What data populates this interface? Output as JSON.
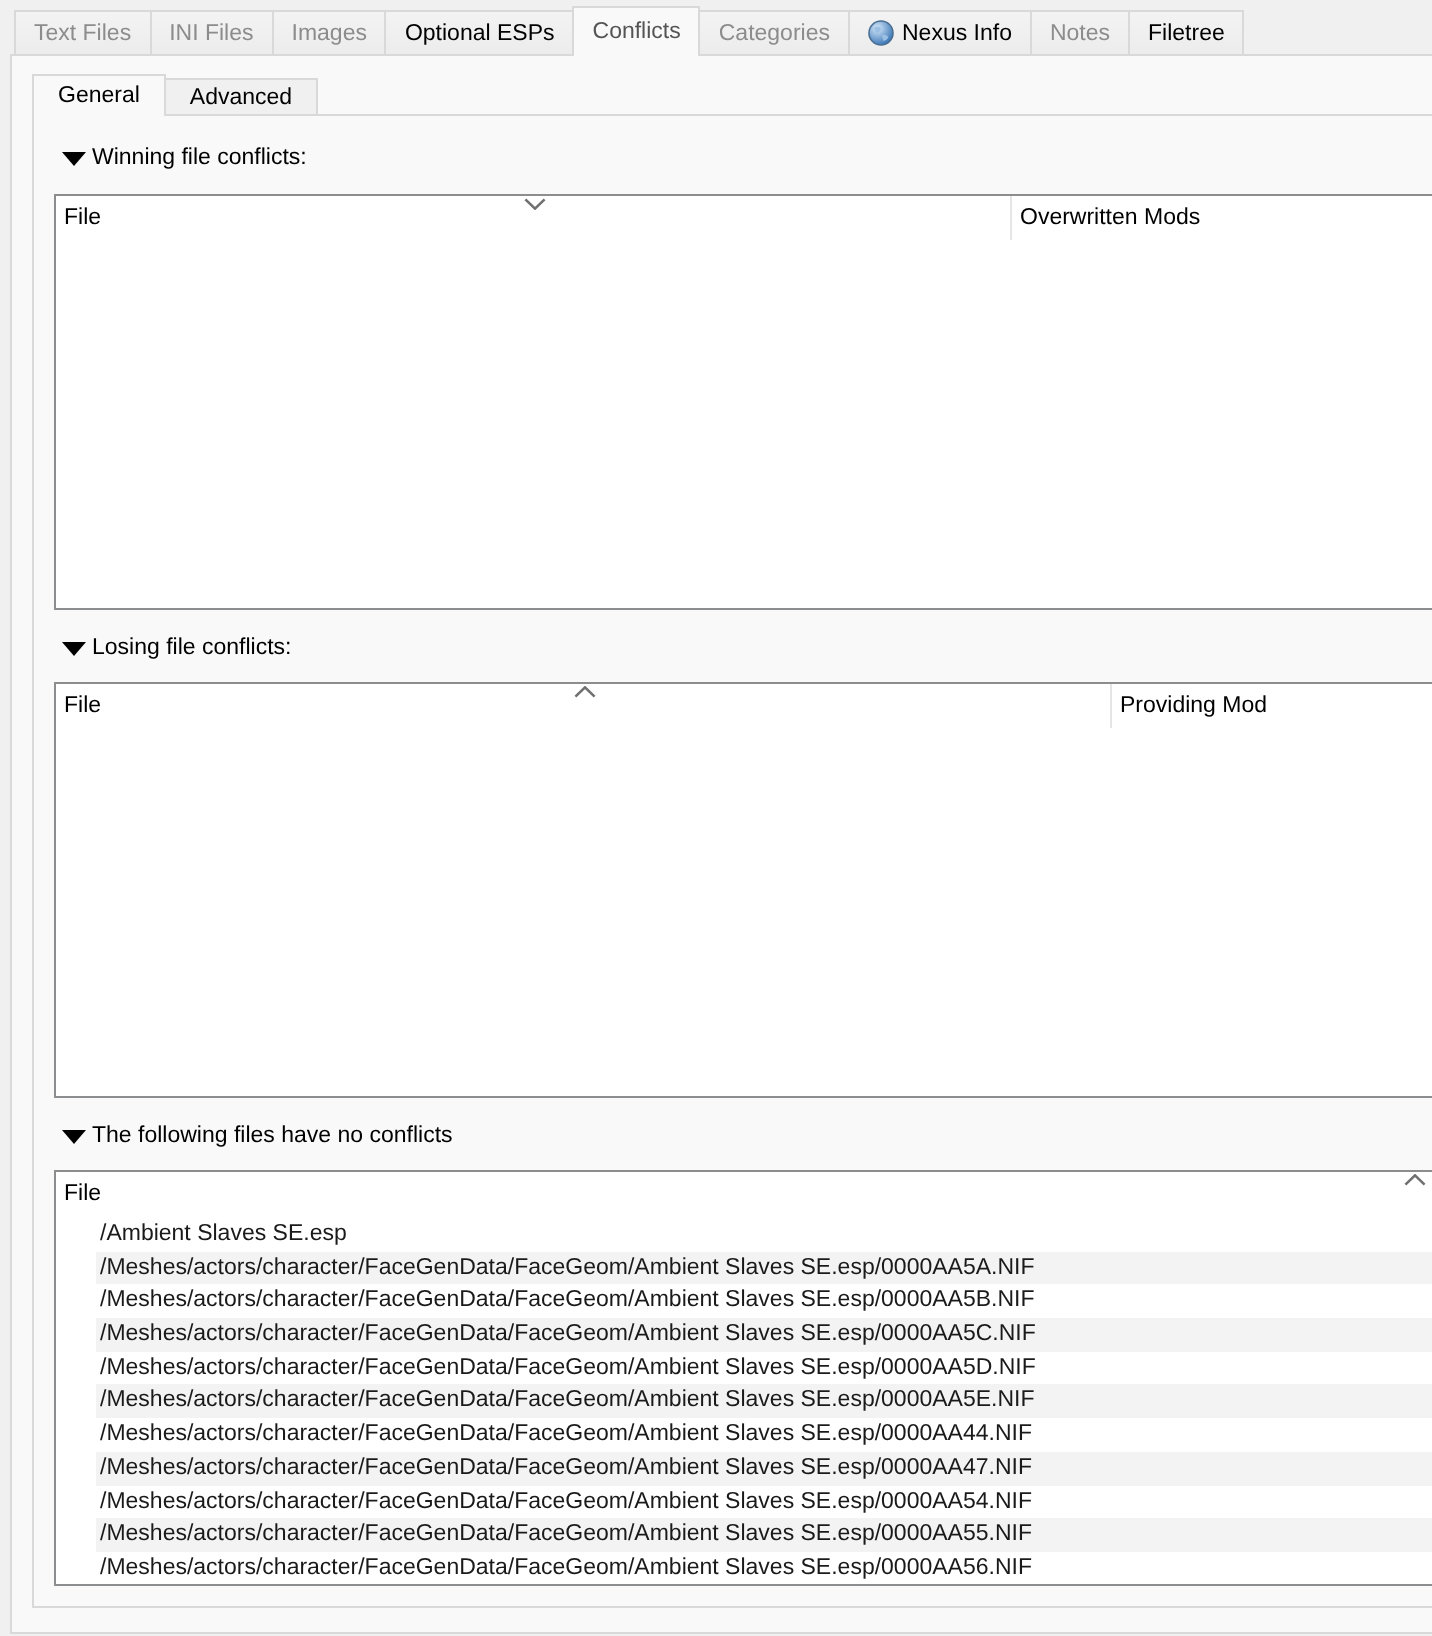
{
  "tabs": [
    {
      "label": "Text Files",
      "kind": "text",
      "selected": false,
      "disabled": true
    },
    {
      "label": "INI Files",
      "kind": "text",
      "selected": false,
      "disabled": true
    },
    {
      "label": "Images",
      "kind": "text",
      "selected": false,
      "disabled": true
    },
    {
      "label": "Optional ESPs",
      "kind": "text",
      "selected": false,
      "disabled": false
    },
    {
      "label": "Conflicts",
      "kind": "text",
      "selected": true,
      "disabled": false
    },
    {
      "label": "Categories",
      "kind": "text",
      "selected": false,
      "disabled": true
    },
    {
      "label": "Nexus Info",
      "kind": "globe",
      "selected": false,
      "disabled": false
    },
    {
      "label": "Notes",
      "kind": "text",
      "selected": false,
      "disabled": true
    },
    {
      "label": "Filetree",
      "kind": "text",
      "selected": false,
      "disabled": false
    }
  ],
  "subtabs": [
    {
      "label": "General",
      "selected": true
    },
    {
      "label": "Advanced",
      "selected": false
    }
  ],
  "sections": [
    {
      "title": "Winning file conflicts:",
      "expanded": true,
      "table": {
        "columns": [
          {
            "label": "File",
            "sorted": true,
            "descending": true
          },
          {
            "label": "Overwritten Mods",
            "sorted": false
          }
        ]
      }
    },
    {
      "title": "Losing file conflicts:",
      "expanded": true,
      "table": {
        "columns": [
          {
            "label": "File",
            "sorted": true,
            "descending": false
          },
          {
            "label": "Providing Mod",
            "sorted": false
          }
        ]
      }
    },
    {
      "title": "The following files have no conflicts",
      "expanded": true,
      "table": {
        "columns": [
          {
            "label": "File",
            "sorted": true,
            "descending": false
          }
        ],
        "rows": [
          "/Ambient Slaves SE.esp",
          "/Meshes/actors/character/FaceGenData/FaceGeom/Ambient Slaves SE.esp/0000AA5A.NIF",
          "/Meshes/actors/character/FaceGenData/FaceGeom/Ambient Slaves SE.esp/0000AA5B.NIF",
          "/Meshes/actors/character/FaceGenData/FaceGeom/Ambient Slaves SE.esp/0000AA5C.NIF",
          "/Meshes/actors/character/FaceGenData/FaceGeom/Ambient Slaves SE.esp/0000AA5D.NIF",
          "/Meshes/actors/character/FaceGenData/FaceGeom/Ambient Slaves SE.esp/0000AA5E.NIF",
          "/Meshes/actors/character/FaceGenData/FaceGeom/Ambient Slaves SE.esp/0000AA44.NIF",
          "/Meshes/actors/character/FaceGenData/FaceGeom/Ambient Slaves SE.esp/0000AA47.NIF",
          "/Meshes/actors/character/FaceGenData/FaceGeom/Ambient Slaves SE.esp/0000AA54.NIF",
          "/Meshes/actors/character/FaceGenData/FaceGeom/Ambient Slaves SE.esp/0000AA55.NIF",
          "/Meshes/actors/character/FaceGenData/FaceGeom/Ambient Slaves SE.esp/0000AA56.NIF"
        ]
      }
    }
  ]
}
